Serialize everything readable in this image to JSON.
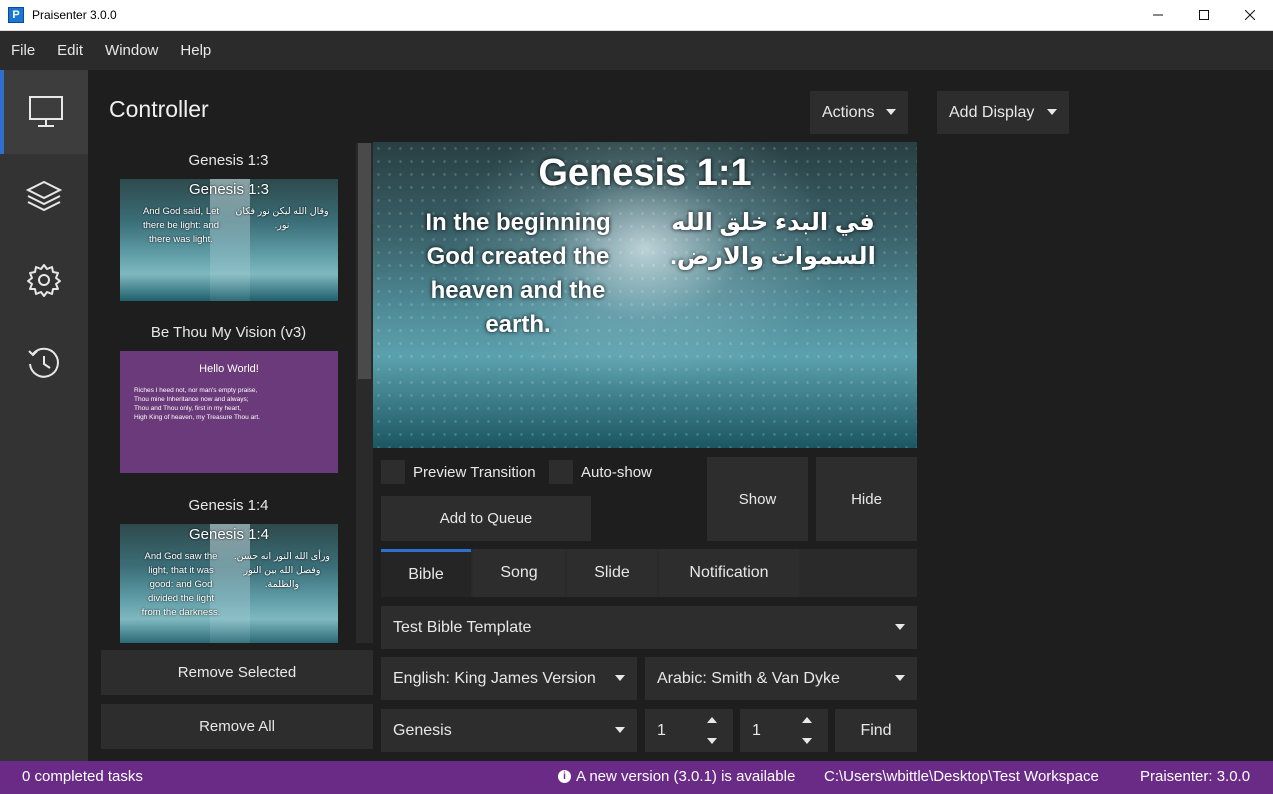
{
  "window": {
    "title": "Praisenter 3.0.0",
    "app_icon_letter": "P"
  },
  "menu": [
    "File",
    "Edit",
    "Window",
    "Help"
  ],
  "sidenav": [
    "monitor-icon",
    "layers-icon",
    "gear-icon",
    "history-icon"
  ],
  "page": {
    "title": "Controller"
  },
  "header_buttons": {
    "actions": "Actions",
    "add_display": "Add Display"
  },
  "queue": [
    {
      "title": "Genesis 1:3",
      "thumb_title": "Genesis 1:3",
      "en": "And God said, Let\nthere be light: and\nthere was light.",
      "ar": "وقال الله ليكن نور فكان\nنور."
    },
    {
      "title": "Be Thou My Vision (v3)",
      "thumb_title": "Hello World!",
      "body": "Riches I heed not, nor man's empty praise,\nThou mine Inheritance now and always;\nThou and Thou only, first in my heart,\nHigh King of heaven, my Treasure Thou art."
    },
    {
      "title": "Genesis 1:4",
      "thumb_title": "Genesis 1:4",
      "en": "And God saw the\nlight, that it was\ngood: and God\ndivided the light\nfrom the darkness.",
      "ar": "ورأى الله النور انه حسن.\nوفصل الله بين النور\nوالظلمة."
    }
  ],
  "queue_buttons": {
    "remove_selected": "Remove Selected",
    "remove_all": "Remove All"
  },
  "preview": {
    "title": "Genesis 1:1",
    "english": "In the beginning\nGod created the\nheaven and the\nearth.",
    "arabic": "في البدء خلق الله\nالسموات والارض."
  },
  "controls": {
    "preview_transition": "Preview Transition",
    "auto_show": "Auto-show",
    "add_to_queue": "Add to Queue",
    "show": "Show",
    "hide": "Hide"
  },
  "tabs": [
    "Bible",
    "Song",
    "Slide",
    "Notification"
  ],
  "bible": {
    "template": "Test Bible Template",
    "primary_translation": "English: King James Version",
    "secondary_translation": "Arabic: Smith & Van Dyke",
    "book": "Genesis",
    "chapter": "1",
    "verse": "1",
    "find": "Find"
  },
  "status": {
    "tasks": "0 completed tasks",
    "update": "A new version (3.0.1) is available",
    "workspace": "C:\\Users\\wbittle\\Desktop\\Test Workspace",
    "version": "Praisenter: 3.0.0"
  }
}
